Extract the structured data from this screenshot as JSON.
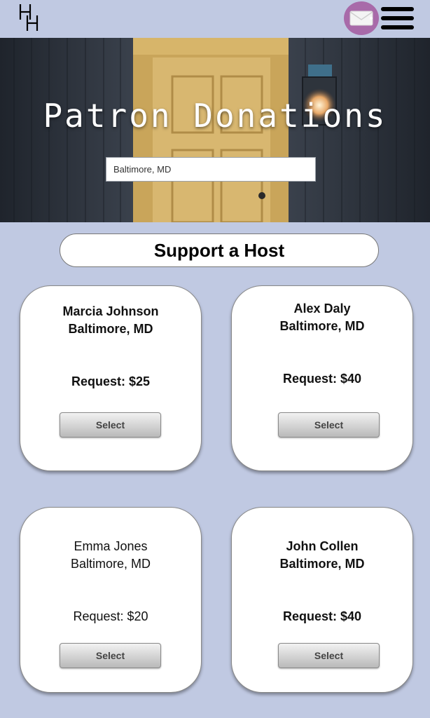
{
  "header": {
    "logo_icon": "hh-logo-icon",
    "mail_icon": "envelope-icon",
    "menu_icon": "hamburger-menu-icon"
  },
  "hero": {
    "title": "Patron Donations",
    "search_value": "Baltimore, MD"
  },
  "section": {
    "heading": "Support a Host"
  },
  "hosts": [
    {
      "name": "Marcia Johnson",
      "city": "Baltimore, MD",
      "request": "Request: $25",
      "button": "Select"
    },
    {
      "name": "Alex Daly",
      "city": "Baltimore, MD",
      "request": "Request: $40",
      "button": "Select"
    },
    {
      "name": "Emma Jones",
      "city": "Baltimore, MD",
      "request": "Request: $20",
      "button": "Select"
    },
    {
      "name": "John Collen",
      "city": "Baltimore, MD",
      "request": "Request: $40",
      "button": "Select"
    }
  ],
  "colors": {
    "page_background": "#c0c9e2",
    "mail_button": "#a86aa9",
    "card_background": "#ffffff"
  }
}
